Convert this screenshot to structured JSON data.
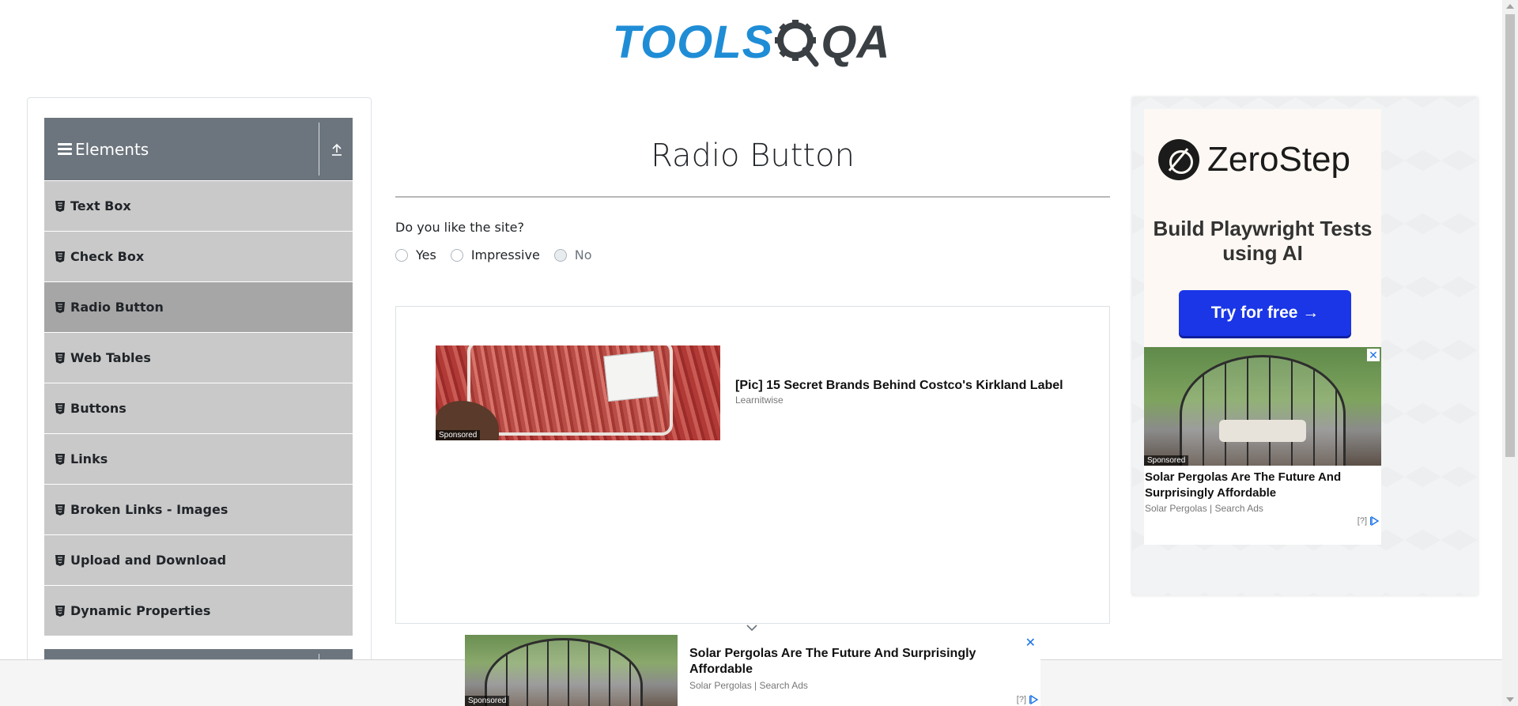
{
  "header": {
    "logo_part1": "TOOLS",
    "logo_part2": "QA"
  },
  "sidebar": {
    "group_title": "Elements",
    "items": [
      {
        "label": "Text Box",
        "active": false
      },
      {
        "label": "Check Box",
        "active": false
      },
      {
        "label": "Radio Button",
        "active": true
      },
      {
        "label": "Web Tables",
        "active": false
      },
      {
        "label": "Buttons",
        "active": false
      },
      {
        "label": "Links",
        "active": false
      },
      {
        "label": "Broken Links - Images",
        "active": false
      },
      {
        "label": "Upload and Download",
        "active": false
      },
      {
        "label": "Dynamic Properties",
        "active": false
      }
    ]
  },
  "main": {
    "title": "Radio Button",
    "question": "Do you like the site?",
    "radios": [
      {
        "label": "Yes",
        "disabled": false
      },
      {
        "label": "Impressive",
        "disabled": false
      },
      {
        "label": "No",
        "disabled": true
      }
    ],
    "ad": {
      "sponsored": "Sponsored",
      "headline": "[Pic] 15 Secret Brands Behind Costco's Kirkland Label",
      "source": "Learnitwise"
    }
  },
  "right_ad": {
    "brand": "ZeroStep",
    "tagline": "Build Playwright Tests using AI",
    "cta": "Try for free →",
    "sponsored": "Sponsored",
    "close": "✕",
    "title": "Solar Pergolas Are The Future And Surprisingly Affordable",
    "source": "Solar Pergolas | Search Ads",
    "adchoice": "[?]"
  },
  "bottom_ad": {
    "sponsored": "Sponsored",
    "title": "Solar Pergolas Are The Future And Surprisingly Affordable",
    "source": "Solar Pergolas | Search Ads",
    "close": "✕",
    "adchoice": "[?]"
  },
  "colors": {
    "accent_blue": "#1f8dd6",
    "sidebar_header": "#6c757d",
    "menu_item": "#c9c9c9",
    "menu_active": "#a6a6a6",
    "cta_blue": "#1a36e6"
  }
}
